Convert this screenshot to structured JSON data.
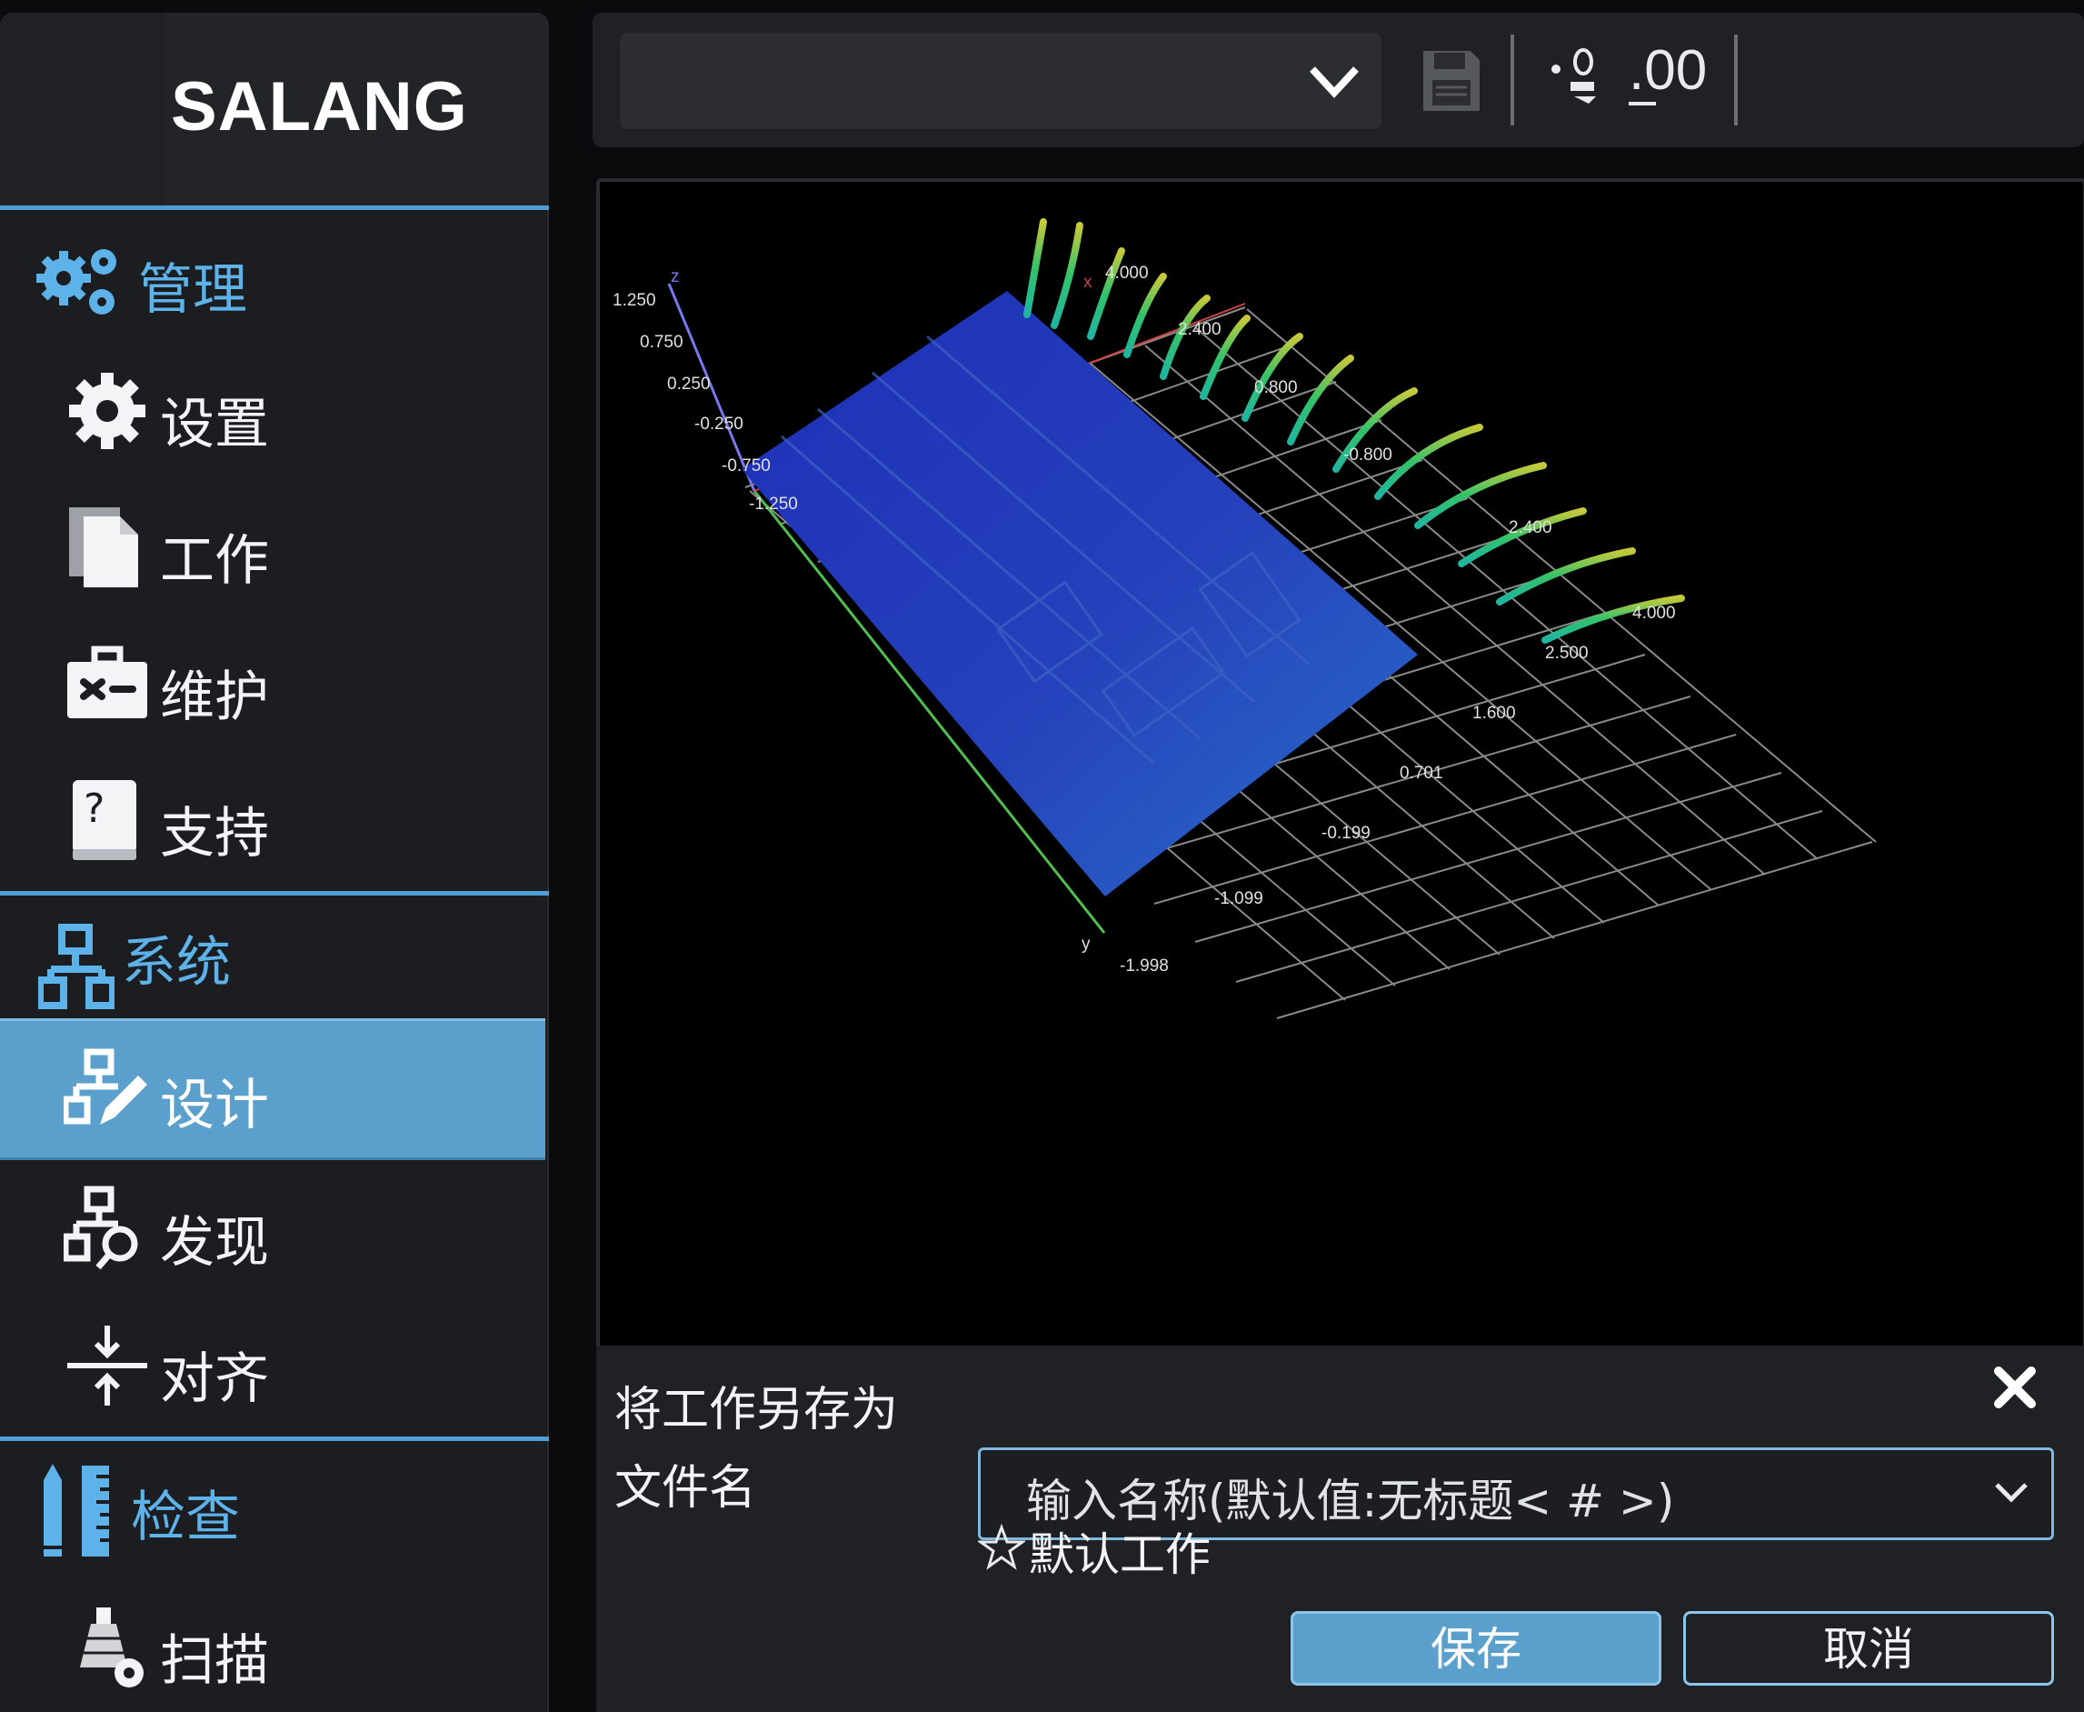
{
  "brand": {
    "name": "SALANG"
  },
  "nav": {
    "sections": [
      {
        "icon": "gears-icon",
        "label": "管理",
        "items": [
          {
            "icon": "gear-icon",
            "label": "设置"
          },
          {
            "icon": "document-icon",
            "label": "工作"
          },
          {
            "icon": "toolbox-icon",
            "label": "维护"
          },
          {
            "icon": "help-book-icon",
            "label": "支持"
          }
        ]
      },
      {
        "icon": "network-icon",
        "label": "系统",
        "items": [
          {
            "icon": "design-icon",
            "label": "设计",
            "active": true
          },
          {
            "icon": "discover-icon",
            "label": "发现"
          },
          {
            "icon": "align-icon",
            "label": "对齐"
          }
        ]
      },
      {
        "icon": "measure-icon",
        "label": "检查",
        "items": [
          {
            "icon": "scan-icon",
            "label": "扫描"
          }
        ]
      }
    ]
  },
  "toolbar": {
    "selected_value": "",
    "save_icon": "save-icon",
    "decimals_label": ".00"
  },
  "viewer": {
    "z_axis_label": "z",
    "x_axis_label": "x",
    "y_axis_label": "y",
    "z_ticks": [
      "1.250",
      "0.750",
      "0.250",
      "-0.250",
      "-0.750",
      "-1.250"
    ],
    "x_ticks": [
      "4.000",
      "2.400",
      "0.800",
      "-0.800",
      "2.400",
      "4.000"
    ],
    "y_ticks": [
      "2.500",
      "1.600",
      "0.701",
      "-0.199",
      "-1.099",
      "-1.998"
    ],
    "colors": {
      "plane": "#2a4fc7",
      "grid": "#9a9a9a",
      "z_axis": "#7777ee",
      "y_axis": "#4fc04f"
    }
  },
  "dialog": {
    "title": "将工作另存为",
    "filename_label": "文件名",
    "filename_placeholder": "输入名称(默认值:无标题< # >)",
    "default_job_label": "默认工作",
    "save_label": "保存",
    "cancel_label": "取消",
    "accent": "#5b9fcc"
  }
}
